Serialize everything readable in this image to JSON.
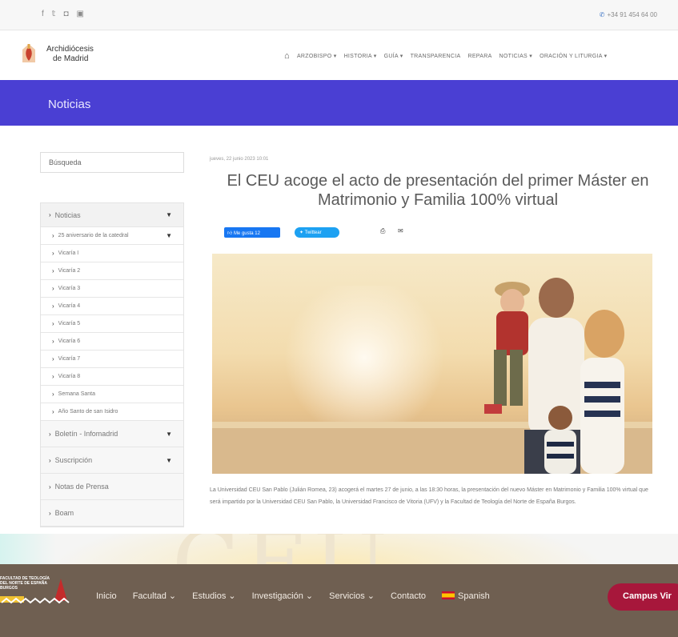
{
  "topbar": {
    "social_icons": [
      "facebook-icon",
      "twitter-icon",
      "instagram-icon",
      "youtube-icon"
    ],
    "phone": "+34 91 454 64 00"
  },
  "header": {
    "logo_line1": "Archidiócesis",
    "logo_line2": "de Madrid",
    "nav": [
      "ARZOBISPO ▾",
      "HISTORIA ▾",
      "GUÍA ▾",
      "TRANSPARENCIA",
      "REPARA",
      "NOTICIAS ▾",
      "ORACIÓN Y LITURGIA ▾"
    ]
  },
  "banner": {
    "title": "Noticias"
  },
  "sidebar": {
    "search_placeholder": "Búsqueda",
    "items": [
      {
        "label": "Noticias",
        "kind": "top",
        "caret": true
      },
      {
        "label": "25 aniversario de la catedral",
        "kind": "sub",
        "caret": true
      },
      {
        "label": "Vicaría I",
        "kind": "sub"
      },
      {
        "label": "Vicaría 2",
        "kind": "sub"
      },
      {
        "label": "Vicaría 3",
        "kind": "sub"
      },
      {
        "label": "Vicaría 4",
        "kind": "sub"
      },
      {
        "label": "Vicaría 5",
        "kind": "sub"
      },
      {
        "label": "Vicaría 6",
        "kind": "sub"
      },
      {
        "label": "Vicaría 7",
        "kind": "sub"
      },
      {
        "label": "Vicaría 8",
        "kind": "sub"
      },
      {
        "label": "Semana Santa",
        "kind": "sub"
      },
      {
        "label": "Año Santo de san Isidro",
        "kind": "sub"
      },
      {
        "label": "Boletín - Infomadrid",
        "kind": "big",
        "caret": true
      },
      {
        "label": "Suscripción",
        "kind": "big",
        "caret": true
      },
      {
        "label": "Notas de Prensa",
        "kind": "big"
      },
      {
        "label": "Boam",
        "kind": "big"
      }
    ]
  },
  "article": {
    "date": "jueves, 22 junio 2023 10:01",
    "title": "El CEU acoge el acto de presentación del primer Máster en Matrimonio y Familia 100% virtual",
    "like_label": "Me gusta 12",
    "tweet_label": "Twittear",
    "body": "La Universidad CEU San Pablo (Julián Romea, 23) acogerá el martes 27 de junio, a las 18:30 horas, la presentación del nuevo Máster en Matrimonio y Familia 100% virtual que será impartido por la Universidad CEU San Pablo, la Universidad Francisco de Vitoria (UFV) y la Facultad de Teología del Norte de España Burgos."
  },
  "footer": {
    "logo_text": "FACULTAD DE TEOLOGÍA DEL NORTE DE ESPAÑA BURGOS",
    "nav": [
      "Inicio",
      "Facultad ⌄",
      "Estudios ⌄",
      "Investigación ⌄",
      "Servicios ⌄",
      "Contacto"
    ],
    "language": "Spanish",
    "campus_button": "Campus Vir"
  },
  "background_watermark": "CEU",
  "colors": {
    "banner": "#4a3fd3",
    "footer": "#6f5f51",
    "campus": "#a7173b"
  }
}
